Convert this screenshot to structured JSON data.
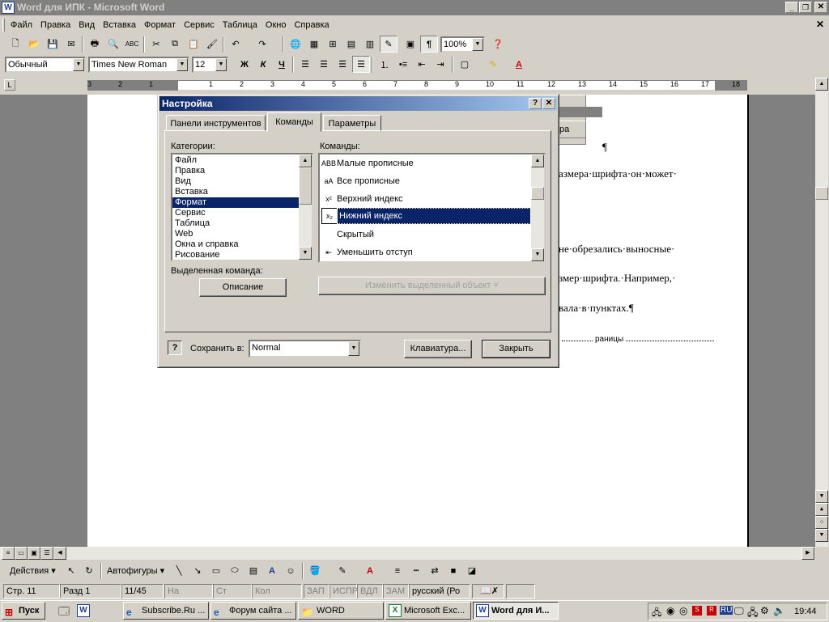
{
  "window": {
    "title": "Word для  ИПК - Microsoft Word"
  },
  "menu": [
    "Файл",
    "Правка",
    "Вид",
    "Вставка",
    "Формат",
    "Сервис",
    "Таблица",
    "Окно",
    "Справка"
  ],
  "format_toolbar": {
    "style": "Обычный",
    "font": "Times New Roman",
    "size": "12",
    "bold": "Ж",
    "italic": "К",
    "underline": "Ч"
  },
  "std_toolbar": {
    "zoom": "100%"
  },
  "ruler": {
    "ticks": [
      "3",
      "2",
      "1",
      "1",
      "2",
      "3",
      "4",
      "5",
      "6",
      "7",
      "8",
      "9",
      "10",
      "11",
      "12",
      "13",
      "14",
      "15",
      "16",
      "17",
      "18"
    ]
  },
  "document": {
    "pilcrow": "¶",
    "line1": "азмера·шрифта·он·может·",
    "line2": "не·обрезались·выносные·",
    "line3": "змер·шрифта.·Например,·",
    "line4": "вала·в·пунктах.¶",
    "footer": "раницы",
    "bg_button": "ра"
  },
  "dialog": {
    "title": "Настройка",
    "tabs": [
      "Панели инструментов",
      "Команды",
      "Параметры"
    ],
    "categories_label": "Категории:",
    "categories": [
      "Файл",
      "Правка",
      "Вид",
      "Вставка",
      "Формат",
      "Сервис",
      "Таблица",
      "Web",
      "Окна и справка",
      "Рисование"
    ],
    "selected_category": "Формат",
    "commands_label": "Команды:",
    "commands": [
      {
        "icon": "АВВ",
        "label": "Малые прописные"
      },
      {
        "icon": "aA",
        "label": "Все прописные"
      },
      {
        "icon": "x²",
        "label": "Верхний индекс"
      },
      {
        "icon": "x₂",
        "label": "Нижний индекс"
      },
      {
        "icon": "",
        "label": "Скрытый"
      },
      {
        "icon": "⇤",
        "label": "Уменьшить отступ"
      }
    ],
    "selected_command": "Нижний индекс",
    "selected_cmd_label": "Выделенная команда:",
    "describe_btn": "Описание",
    "modify_btn": "Изменить выделенный объект ˅",
    "save_in_label": "Сохранить в:",
    "save_in_value": "Normal",
    "keyboard_btn": "Клавиатура...",
    "close_btn": "Закрыть"
  },
  "drawing_toolbar": {
    "actions": "Действия",
    "autoshapes": "Автофигуры"
  },
  "status": {
    "page": "Стр. 11",
    "section": "Разд 1",
    "pages": "11/45",
    "at": "На",
    "line": "Ст",
    "col": "Кол",
    "rec": "ЗАП",
    "trk": "ИСПР",
    "ext": "ВДЛ",
    "ovr": "ЗАМ",
    "lang": "русский (Ро"
  },
  "taskbar": {
    "start": "Пуск",
    "items": [
      "Subscribe.Ru ...",
      "Форум сайта ...",
      "WORD",
      "Microsoft Exc...",
      "Word для  И..."
    ],
    "clock": "19:44",
    "lang": "RU"
  }
}
